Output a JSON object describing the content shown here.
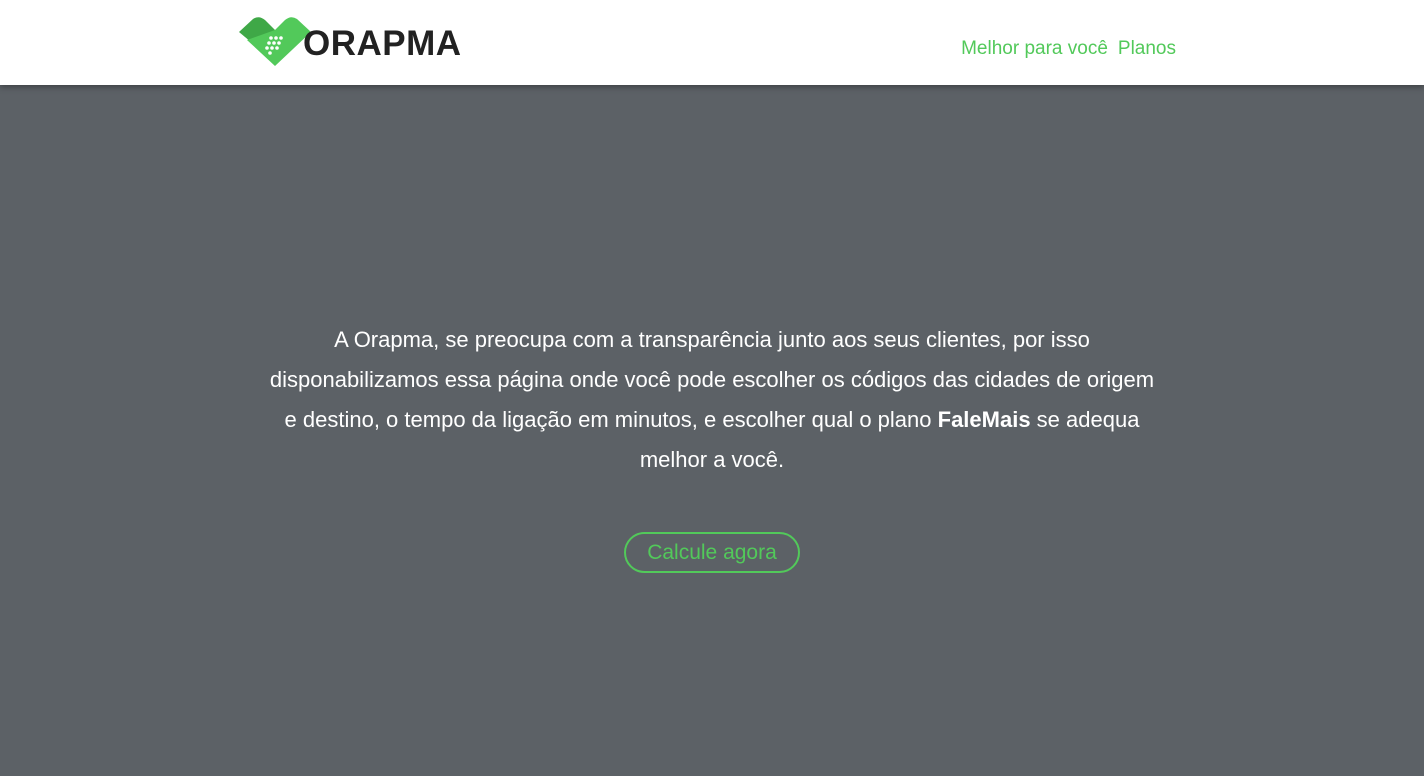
{
  "brand": {
    "name": "ORAPMA",
    "logo_icon": "heart-phone-keypad-icon",
    "accent_color": "#52c95a",
    "accent_dark": "#3fa847"
  },
  "nav": {
    "items": [
      {
        "label": "Melhor para você"
      },
      {
        "label": "Planos"
      }
    ]
  },
  "hero": {
    "text_before": "A Orapma, se preocupa com a transparência junto aos seus clientes, por isso disponabilizamos essa página onde você pode escolher os códigos das cidades de origem e destino, o tempo da ligação em minutos, e escolher qual o plano ",
    "text_bold": "FaleMais",
    "text_after": " se adequa melhor a você.",
    "cta_label": "Calcule agora"
  },
  "colors": {
    "header_bg": "#ffffff",
    "hero_bg": "#5c6166",
    "hero_text": "#ffffff"
  }
}
